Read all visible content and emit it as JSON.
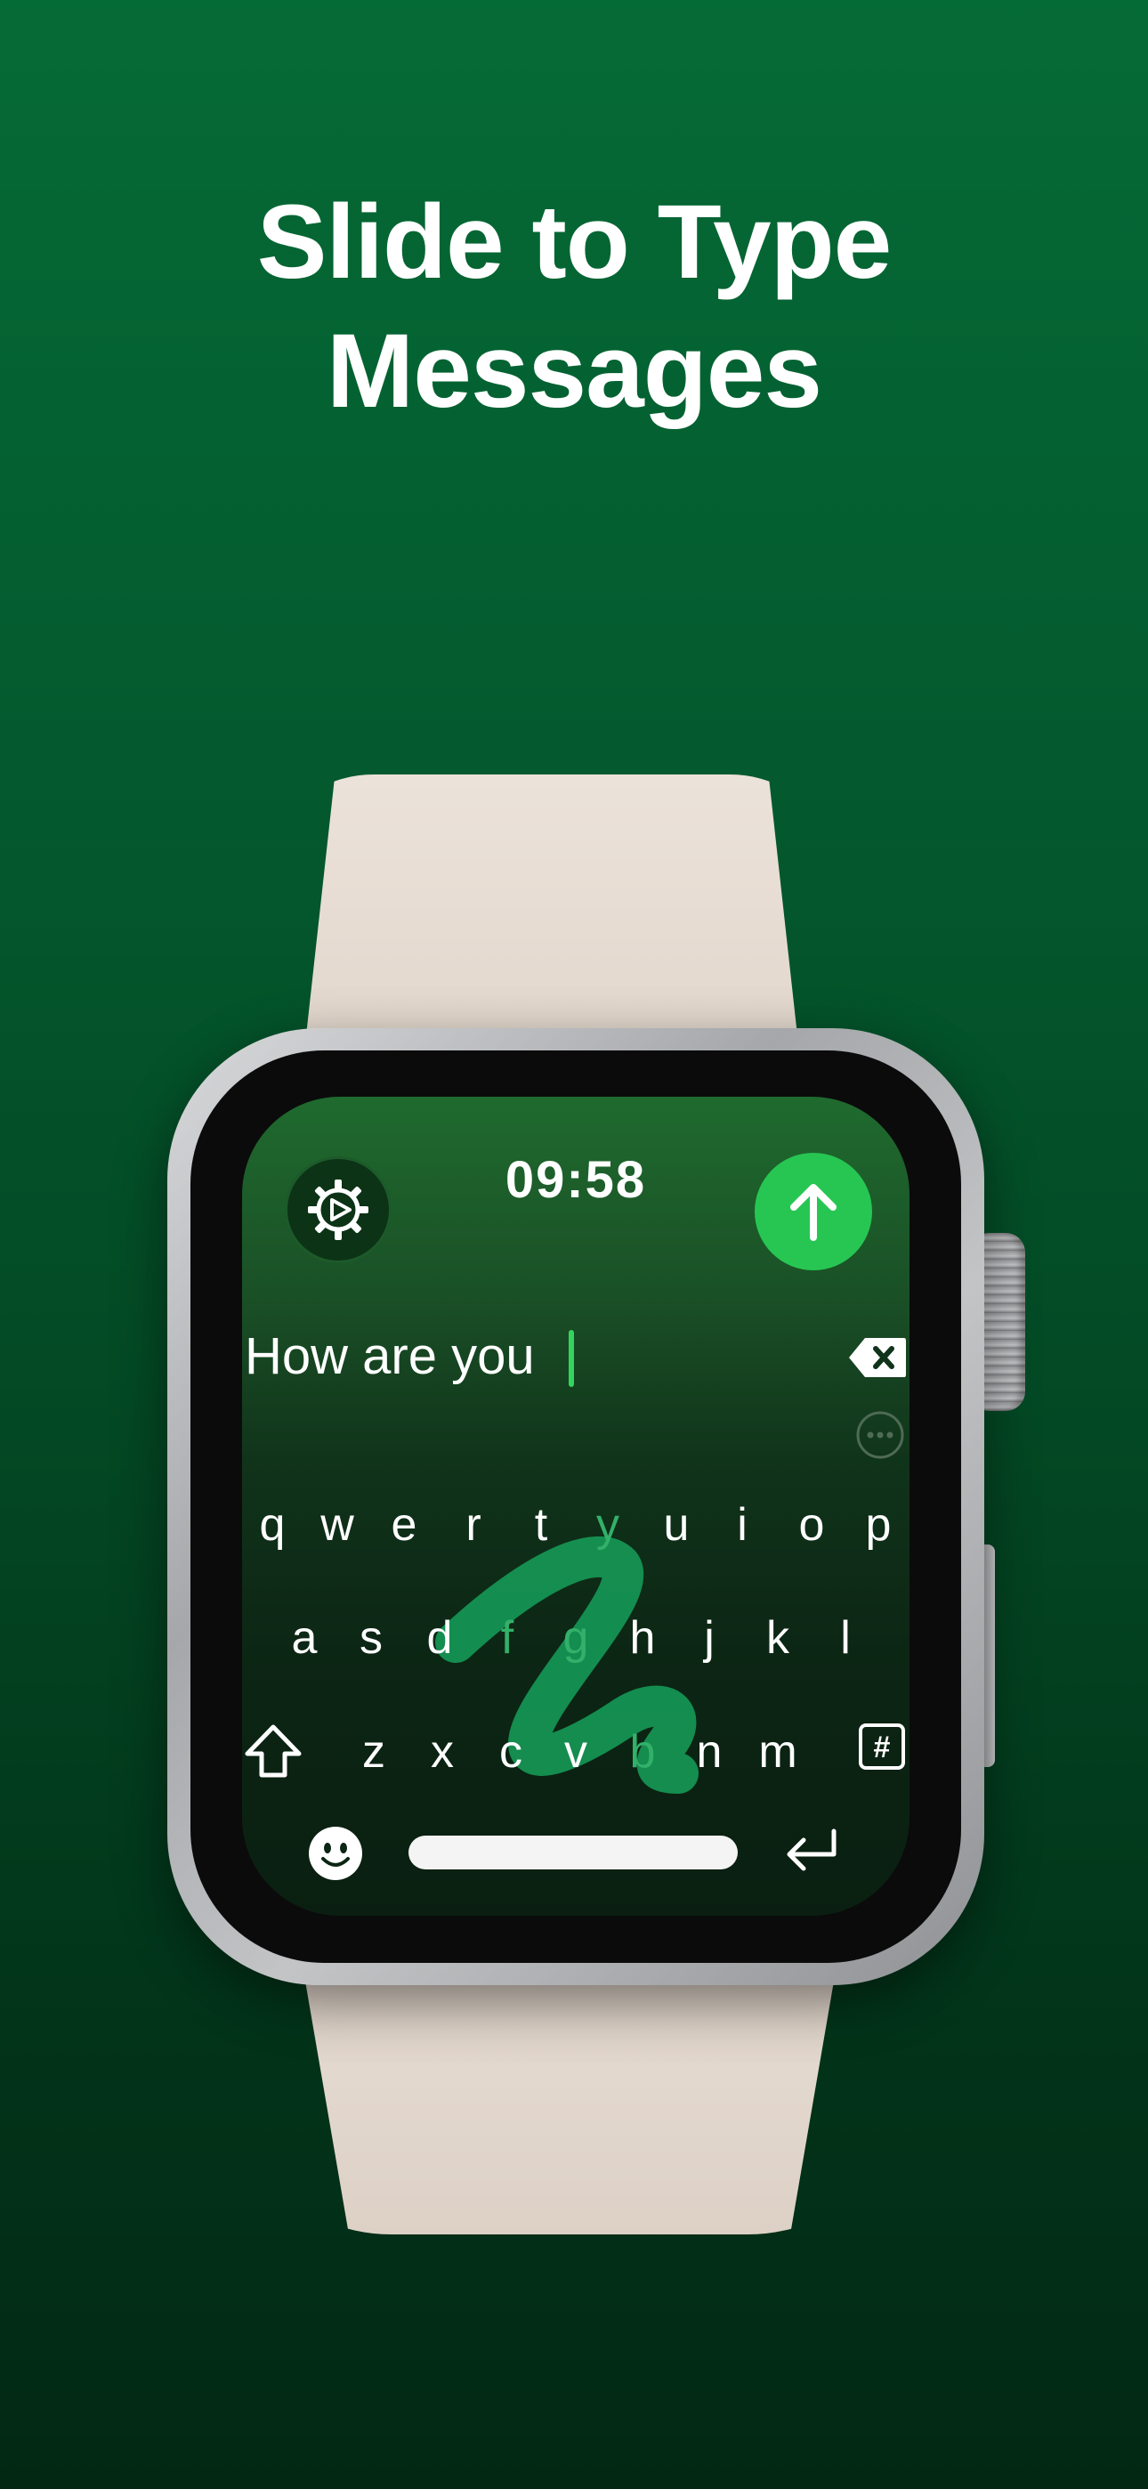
{
  "headline": {
    "line1": "Slide to Type",
    "line2": "Messages"
  },
  "watch": {
    "time": "09:58",
    "message_text": "How are you",
    "settings_icon": "gear-play-icon",
    "send_icon": "arrow-up-icon",
    "backspace_icon": "backspace-icon",
    "more_icon": "ellipsis-circle-icon"
  },
  "keyboard": {
    "row1": [
      "q",
      "w",
      "e",
      "r",
      "t",
      "y",
      "u",
      "i",
      "o",
      "p"
    ],
    "row2": [
      "a",
      "s",
      "d",
      "f",
      "g",
      "h",
      "j",
      "k",
      "l"
    ],
    "row3": [
      "z",
      "x",
      "c",
      "v",
      "b",
      "n",
      "m"
    ],
    "shift_icon": "shift-icon",
    "symbols_label": "#",
    "emoji_icon": "emoji-icon",
    "return_icon": "return-icon",
    "highlighted_keys": [
      "y",
      "f",
      "g",
      "b"
    ]
  },
  "colors": {
    "background_top": "#056b36",
    "background_bottom": "#022814",
    "accent_green": "#27c653",
    "trace_green": "#16a05a",
    "band": "#e6dcd2"
  }
}
